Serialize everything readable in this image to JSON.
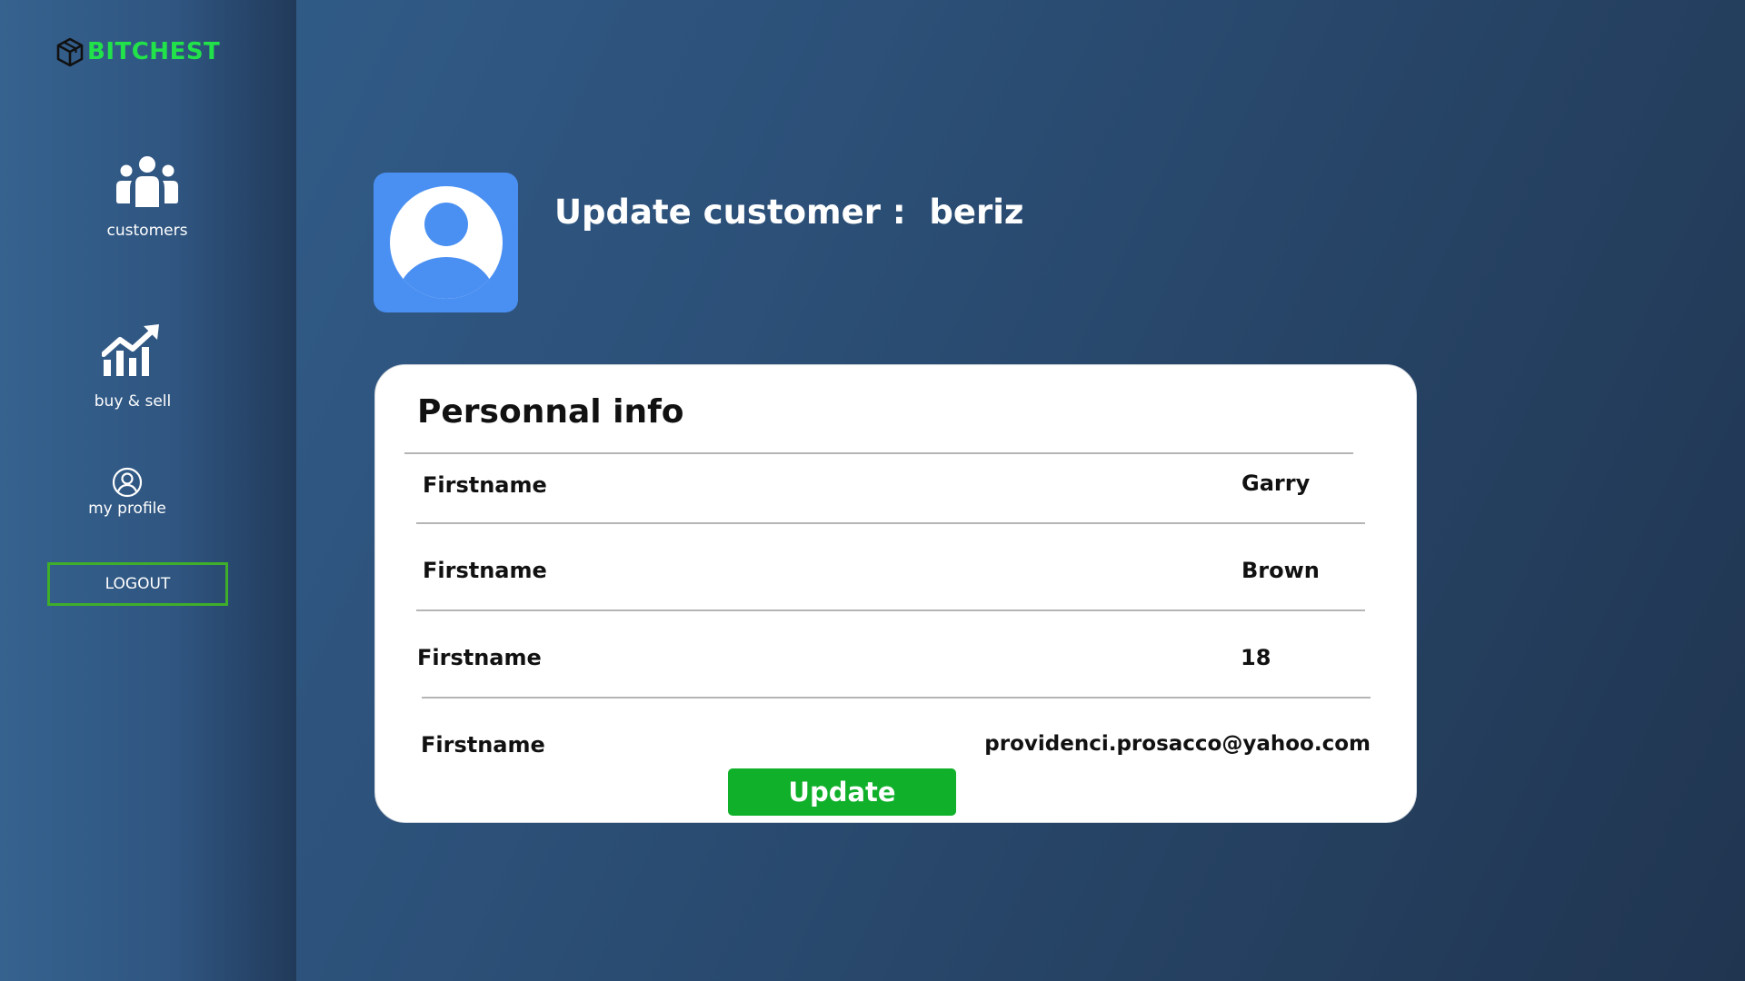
{
  "brand": {
    "name": "BITCHEST",
    "logo_icon": "cube-box-icon",
    "accent_color": "#22e24a"
  },
  "sidebar": {
    "items": [
      {
        "label": "customers",
        "icon": "users-group-icon"
      },
      {
        "label": "buy & sell",
        "icon": "chart-growth-icon"
      },
      {
        "label": "my profile",
        "icon": "user-circle-icon"
      }
    ],
    "logout_label": "LOGOUT"
  },
  "header": {
    "title": "Update customer :  beriz",
    "avatar_icon": "user-avatar-icon"
  },
  "card": {
    "title": "Personnal info",
    "fields": [
      {
        "label": "Firstname",
        "value": "Garry"
      },
      {
        "label": "Firstname",
        "value": "Brown"
      },
      {
        "label": "Firstname",
        "value": "18"
      },
      {
        "label": "Firstname",
        "value": "providenci.prosacco@yahoo.com"
      }
    ],
    "update_label": "Update"
  },
  "colors": {
    "update_button": "#10b02a",
    "logout_border": "#3fae2a",
    "avatar_background": "#4a90f2"
  }
}
